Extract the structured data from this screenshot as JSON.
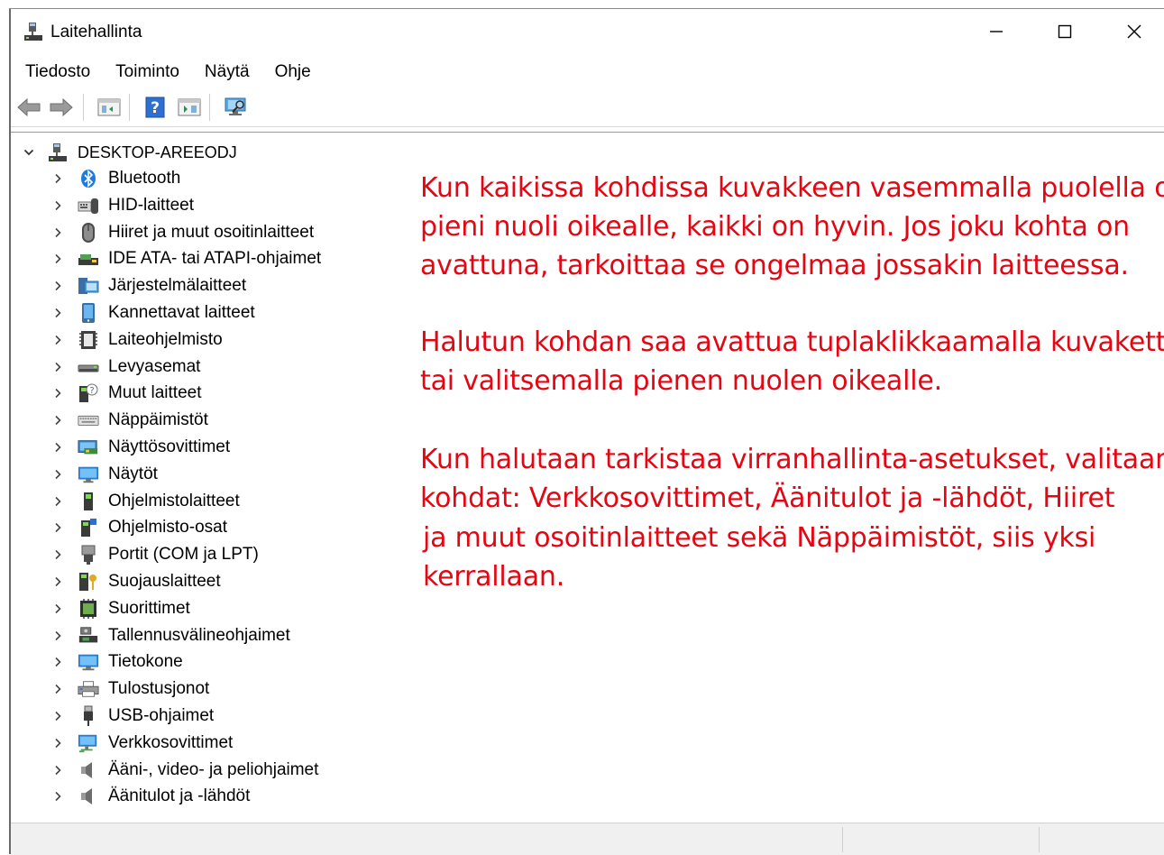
{
  "window": {
    "title": "Laitehallinta",
    "controls": {
      "minimize": "—",
      "maximize": "☐",
      "close": "✕"
    }
  },
  "menu": [
    "Tiedosto",
    "Toiminto",
    "Näytä",
    "Ohje"
  ],
  "toolbar": [
    "back-icon",
    "forward-icon",
    "show-hide-console-tree-icon",
    "help-icon",
    "action-pane-icon",
    "scan-hardware-icon"
  ],
  "tree": {
    "root": "DESKTOP-AREEODJ",
    "items": [
      {
        "label": "Bluetooth",
        "icon": "bluetooth-icon"
      },
      {
        "label": "HID-laitteet",
        "icon": "hid-icon"
      },
      {
        "label": "Hiiret ja muut osoitinlaitteet",
        "icon": "mouse-icon"
      },
      {
        "label": "IDE ATA- tai ATAPI-ohjaimet",
        "icon": "ide-controller-icon"
      },
      {
        "label": "Järjestelmälaitteet",
        "icon": "system-devices-icon"
      },
      {
        "label": "Kannettavat laitteet",
        "icon": "portable-device-icon"
      },
      {
        "label": "Laiteohjelmisto",
        "icon": "firmware-icon"
      },
      {
        "label": "Levyasemat",
        "icon": "disk-drive-icon"
      },
      {
        "label": "Muut laitteet",
        "icon": "other-devices-icon"
      },
      {
        "label": "Näppäimistöt",
        "icon": "keyboard-icon"
      },
      {
        "label": "Näyttösovittimet",
        "icon": "display-adapter-icon"
      },
      {
        "label": "Näytöt",
        "icon": "monitor-icon"
      },
      {
        "label": "Ohjelmistolaitteet",
        "icon": "software-device-icon"
      },
      {
        "label": "Ohjelmisto-osat",
        "icon": "software-component-icon"
      },
      {
        "label": "Portit (COM ja LPT)",
        "icon": "port-icon"
      },
      {
        "label": "Suojauslaitteet",
        "icon": "security-device-icon"
      },
      {
        "label": "Suorittimet",
        "icon": "processor-icon"
      },
      {
        "label": "Tallennusvälineohjaimet",
        "icon": "storage-controller-icon"
      },
      {
        "label": "Tietokone",
        "icon": "computer-icon"
      },
      {
        "label": "Tulostusjonot",
        "icon": "print-queue-icon"
      },
      {
        "label": "USB-ohjaimet",
        "icon": "usb-icon"
      },
      {
        "label": "Verkkosovittimet",
        "icon": "network-adapter-icon"
      },
      {
        "label": "Ääni-, video- ja peliohjaimet",
        "icon": "sound-icon"
      },
      {
        "label": "Äänitulot ja -lähdöt",
        "icon": "audio-io-icon"
      }
    ]
  },
  "annotation": {
    "color": "#e30613",
    "lines": [
      "Kun kaikissa kohdissa kuvakkeen vasemmalla puolella on",
      "pieni nuoli oikealle, kaikki on hyvin. Jos joku kohta on",
      "avattuna, tarkoittaa se ongelmaa jossakin laitteessa.",
      "Halutun kohdan saa avattua tuplaklikkaamalla kuvaketta",
      "tai valitsemalla pienen nuolen oikealle.",
      "Kun halutaan tarkistaa virranhallinta-asetukset, valitaan",
      "kohdat: Verkkosovittimet, Äänitulot ja -lähdöt, Hiiret",
      "ja muut osoitinlaitteet sekä Näppäimistöt, siis yksi",
      "kerrallaan."
    ]
  }
}
